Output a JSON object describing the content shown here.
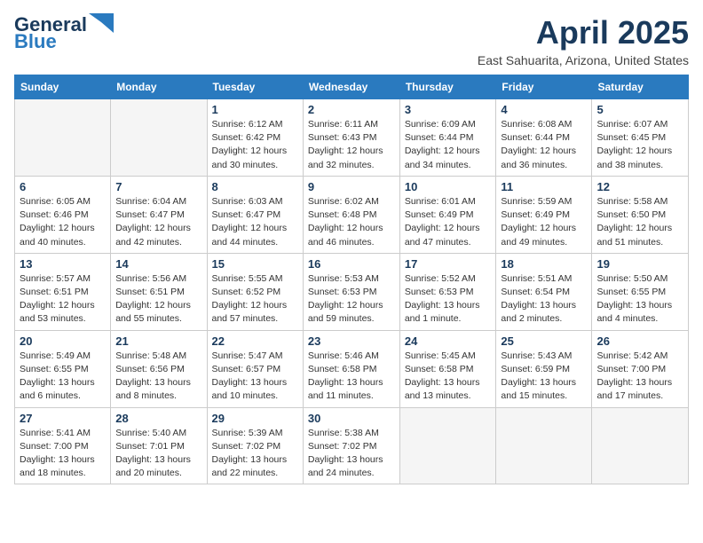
{
  "header": {
    "logo_line1": "General",
    "logo_line2": "Blue",
    "month_title": "April 2025",
    "location": "East Sahuarita, Arizona, United States"
  },
  "days_of_week": [
    "Sunday",
    "Monday",
    "Tuesday",
    "Wednesday",
    "Thursday",
    "Friday",
    "Saturday"
  ],
  "weeks": [
    [
      {
        "day": "",
        "empty": true
      },
      {
        "day": "",
        "empty": true
      },
      {
        "day": "1",
        "sunrise": "Sunrise: 6:12 AM",
        "sunset": "Sunset: 6:42 PM",
        "daylight": "Daylight: 12 hours and 30 minutes."
      },
      {
        "day": "2",
        "sunrise": "Sunrise: 6:11 AM",
        "sunset": "Sunset: 6:43 PM",
        "daylight": "Daylight: 12 hours and 32 minutes."
      },
      {
        "day": "3",
        "sunrise": "Sunrise: 6:09 AM",
        "sunset": "Sunset: 6:44 PM",
        "daylight": "Daylight: 12 hours and 34 minutes."
      },
      {
        "day": "4",
        "sunrise": "Sunrise: 6:08 AM",
        "sunset": "Sunset: 6:44 PM",
        "daylight": "Daylight: 12 hours and 36 minutes."
      },
      {
        "day": "5",
        "sunrise": "Sunrise: 6:07 AM",
        "sunset": "Sunset: 6:45 PM",
        "daylight": "Daylight: 12 hours and 38 minutes."
      }
    ],
    [
      {
        "day": "6",
        "sunrise": "Sunrise: 6:05 AM",
        "sunset": "Sunset: 6:46 PM",
        "daylight": "Daylight: 12 hours and 40 minutes."
      },
      {
        "day": "7",
        "sunrise": "Sunrise: 6:04 AM",
        "sunset": "Sunset: 6:47 PM",
        "daylight": "Daylight: 12 hours and 42 minutes."
      },
      {
        "day": "8",
        "sunrise": "Sunrise: 6:03 AM",
        "sunset": "Sunset: 6:47 PM",
        "daylight": "Daylight: 12 hours and 44 minutes."
      },
      {
        "day": "9",
        "sunrise": "Sunrise: 6:02 AM",
        "sunset": "Sunset: 6:48 PM",
        "daylight": "Daylight: 12 hours and 46 minutes."
      },
      {
        "day": "10",
        "sunrise": "Sunrise: 6:01 AM",
        "sunset": "Sunset: 6:49 PM",
        "daylight": "Daylight: 12 hours and 47 minutes."
      },
      {
        "day": "11",
        "sunrise": "Sunrise: 5:59 AM",
        "sunset": "Sunset: 6:49 PM",
        "daylight": "Daylight: 12 hours and 49 minutes."
      },
      {
        "day": "12",
        "sunrise": "Sunrise: 5:58 AM",
        "sunset": "Sunset: 6:50 PM",
        "daylight": "Daylight: 12 hours and 51 minutes."
      }
    ],
    [
      {
        "day": "13",
        "sunrise": "Sunrise: 5:57 AM",
        "sunset": "Sunset: 6:51 PM",
        "daylight": "Daylight: 12 hours and 53 minutes."
      },
      {
        "day": "14",
        "sunrise": "Sunrise: 5:56 AM",
        "sunset": "Sunset: 6:51 PM",
        "daylight": "Daylight: 12 hours and 55 minutes."
      },
      {
        "day": "15",
        "sunrise": "Sunrise: 5:55 AM",
        "sunset": "Sunset: 6:52 PM",
        "daylight": "Daylight: 12 hours and 57 minutes."
      },
      {
        "day": "16",
        "sunrise": "Sunrise: 5:53 AM",
        "sunset": "Sunset: 6:53 PM",
        "daylight": "Daylight: 12 hours and 59 minutes."
      },
      {
        "day": "17",
        "sunrise": "Sunrise: 5:52 AM",
        "sunset": "Sunset: 6:53 PM",
        "daylight": "Daylight: 13 hours and 1 minute."
      },
      {
        "day": "18",
        "sunrise": "Sunrise: 5:51 AM",
        "sunset": "Sunset: 6:54 PM",
        "daylight": "Daylight: 13 hours and 2 minutes."
      },
      {
        "day": "19",
        "sunrise": "Sunrise: 5:50 AM",
        "sunset": "Sunset: 6:55 PM",
        "daylight": "Daylight: 13 hours and 4 minutes."
      }
    ],
    [
      {
        "day": "20",
        "sunrise": "Sunrise: 5:49 AM",
        "sunset": "Sunset: 6:55 PM",
        "daylight": "Daylight: 13 hours and 6 minutes."
      },
      {
        "day": "21",
        "sunrise": "Sunrise: 5:48 AM",
        "sunset": "Sunset: 6:56 PM",
        "daylight": "Daylight: 13 hours and 8 minutes."
      },
      {
        "day": "22",
        "sunrise": "Sunrise: 5:47 AM",
        "sunset": "Sunset: 6:57 PM",
        "daylight": "Daylight: 13 hours and 10 minutes."
      },
      {
        "day": "23",
        "sunrise": "Sunrise: 5:46 AM",
        "sunset": "Sunset: 6:58 PM",
        "daylight": "Daylight: 13 hours and 11 minutes."
      },
      {
        "day": "24",
        "sunrise": "Sunrise: 5:45 AM",
        "sunset": "Sunset: 6:58 PM",
        "daylight": "Daylight: 13 hours and 13 minutes."
      },
      {
        "day": "25",
        "sunrise": "Sunrise: 5:43 AM",
        "sunset": "Sunset: 6:59 PM",
        "daylight": "Daylight: 13 hours and 15 minutes."
      },
      {
        "day": "26",
        "sunrise": "Sunrise: 5:42 AM",
        "sunset": "Sunset: 7:00 PM",
        "daylight": "Daylight: 13 hours and 17 minutes."
      }
    ],
    [
      {
        "day": "27",
        "sunrise": "Sunrise: 5:41 AM",
        "sunset": "Sunset: 7:00 PM",
        "daylight": "Daylight: 13 hours and 18 minutes."
      },
      {
        "day": "28",
        "sunrise": "Sunrise: 5:40 AM",
        "sunset": "Sunset: 7:01 PM",
        "daylight": "Daylight: 13 hours and 20 minutes."
      },
      {
        "day": "29",
        "sunrise": "Sunrise: 5:39 AM",
        "sunset": "Sunset: 7:02 PM",
        "daylight": "Daylight: 13 hours and 22 minutes."
      },
      {
        "day": "30",
        "sunrise": "Sunrise: 5:38 AM",
        "sunset": "Sunset: 7:02 PM",
        "daylight": "Daylight: 13 hours and 24 minutes."
      },
      {
        "day": "",
        "empty": true
      },
      {
        "day": "",
        "empty": true
      },
      {
        "day": "",
        "empty": true
      }
    ]
  ]
}
